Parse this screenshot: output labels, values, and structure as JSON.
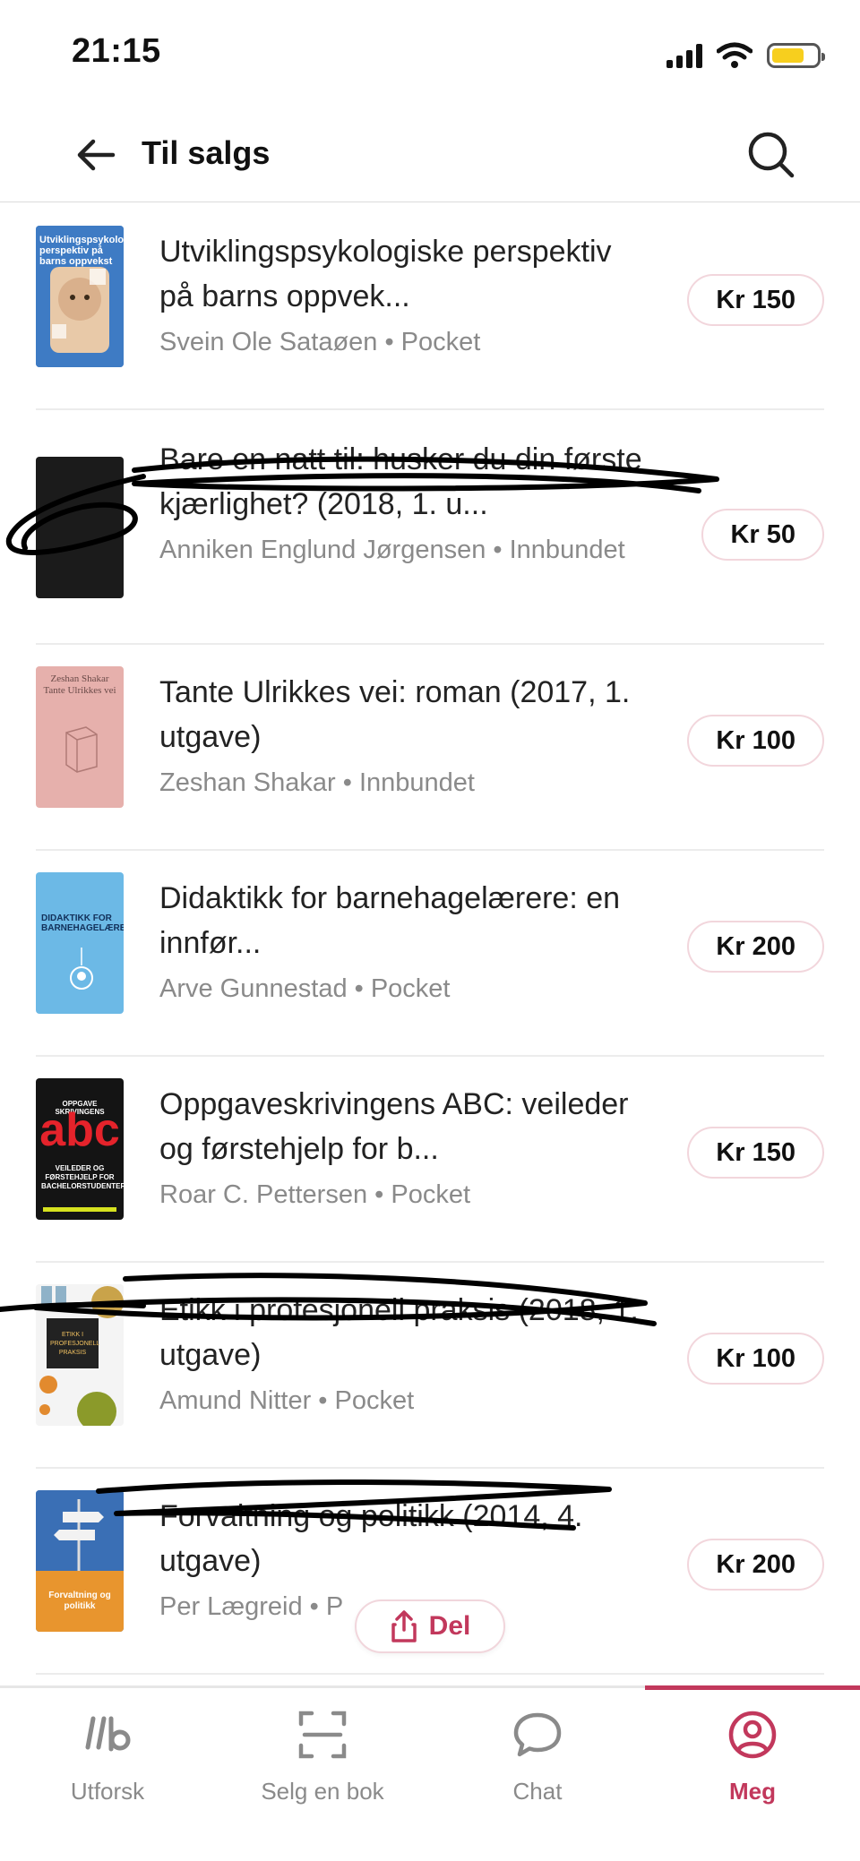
{
  "status_bar": {
    "time": "21:15",
    "icons": [
      "cellular-signal-icon",
      "wifi-icon",
      "battery-icon"
    ],
    "battery_color": "#f7cf1e"
  },
  "header": {
    "title": "Til salgs",
    "back_icon": "arrow-left-icon",
    "search_icon": "search-icon"
  },
  "listings": [
    {
      "title": "Utviklingspsykologiske perspektiv på barns oppvek...",
      "meta": "Svein Ole Sataøen • Pocket",
      "price": "Kr 150",
      "cover_color": "#3e7bc4"
    },
    {
      "title": "Bare en natt til: husker du din første kjærlighet? (2018, 1. u...",
      "meta": "Anniken Englund Jørgensen • Innbundet",
      "price": "Kr 50",
      "cover_color": "#1b1b1b"
    },
    {
      "title": "Tante Ulrikkes vei: roman (2017, 1. utgave)",
      "meta": "Zeshan Shakar • Innbundet",
      "price": "Kr 100",
      "cover_color": "#e6b0ac"
    },
    {
      "title": "Didaktikk for barnehagelærere: en innfør...",
      "meta": "Arve Gunnestad • Pocket",
      "price": "Kr 200",
      "cover_color": "#6cb9e6"
    },
    {
      "title": "Oppgaveskrivingens ABC: veileder og førstehjelp for b...",
      "meta": "Roar C. Pettersen • Pocket",
      "price": "Kr 150",
      "cover_color": "#141414"
    },
    {
      "title": "Etikk i profesjonell praksis (2018, 1. utgave)",
      "meta": "Amund Nitter • Pocket",
      "price": "Kr 100",
      "cover_color": "#f0f0f0"
    },
    {
      "title": "Forvaltning og politikk (2014, 4. utgave)",
      "meta": "Per Lægreid • P",
      "price": "Kr 200",
      "cover_color": "#3a6fb5"
    }
  ],
  "cover_text": {
    "book1": "Utviklingspsykologiske perspektiv på barns oppvekst",
    "book3": "Zeshan Shakar Tante Ulrikkes vei",
    "book4": "DIDAKTIKK FOR BARNEHAGELÆRERE",
    "book5_top": "OPPGAVE  SKRIVINGENS",
    "book5_big": "abc",
    "book5_sub": "VEILEDER OG FØRSTEHJELP FOR BACHELORSTUDENTER",
    "book6": "ETIKK I PROFESJONELL PRAKSIS",
    "book7": "Forvaltning og politikk"
  },
  "share": {
    "label": "Del",
    "icon": "share-icon"
  },
  "tabbar": {
    "tabs": [
      {
        "label": "Utforsk",
        "icon": "logo-lb-icon",
        "active": false
      },
      {
        "label": "Selg en bok",
        "icon": "scan-frame-icon",
        "active": false
      },
      {
        "label": "Chat",
        "icon": "chat-bubble-icon",
        "active": false
      },
      {
        "label": "Meg",
        "icon": "profile-icon",
        "active": true
      }
    ],
    "active_color": "#c2385c"
  }
}
